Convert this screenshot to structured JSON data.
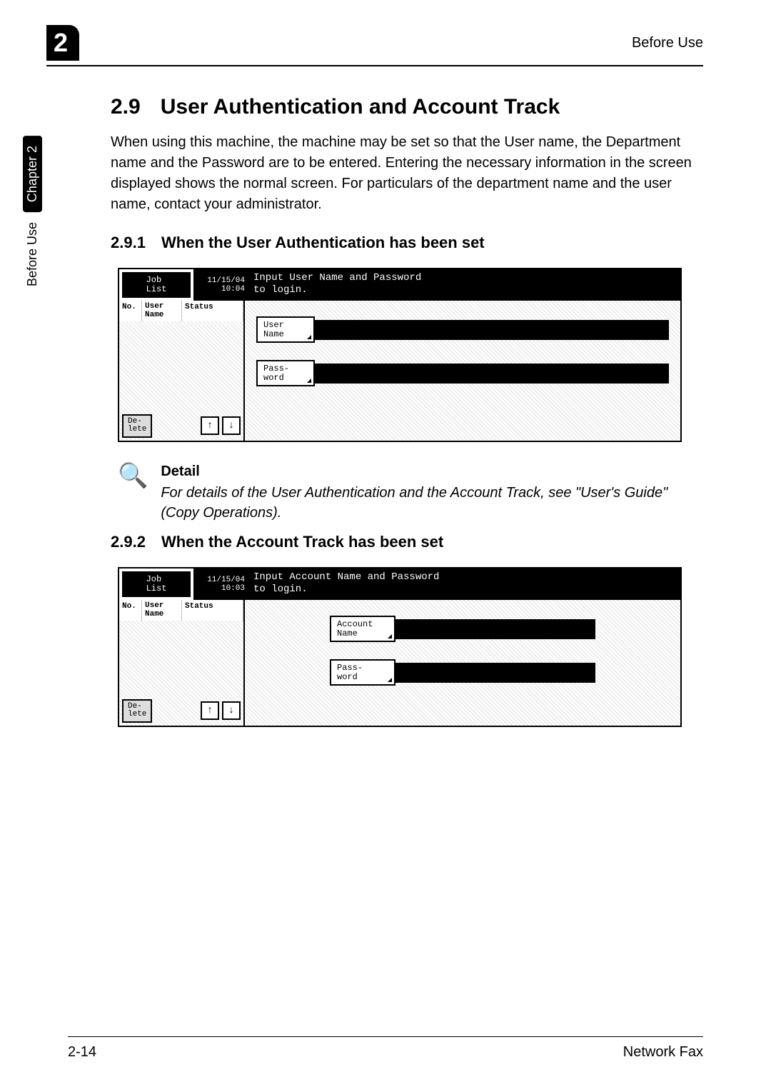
{
  "header": {
    "chapter_badge": "2",
    "running_head": "Before Use"
  },
  "sidebar": {
    "chapter_label": "Chapter 2",
    "section_label": "Before Use"
  },
  "section": {
    "number": "2.9",
    "title": "User Authentication and Account Track",
    "intro": "When using this machine, the machine may be set so that the User name, the Department name and the Password are to be entered. Entering the necessary information in the screen displayed shows the normal screen. For particulars of the department name and the user name, contact your administrator."
  },
  "sub1": {
    "number": "2.9.1",
    "title": "When the User Authentication has been set"
  },
  "panel1": {
    "joblist": "Job\nList",
    "date": "11/15/04",
    "time": "10:04",
    "prompt": "Input User Name and Password\nto login.",
    "col_no": "No.",
    "col_user": "User\nName",
    "col_status": "Status",
    "delete": "De-\nlete",
    "up": "↑",
    "down": "↓",
    "field1": "User\nName",
    "field2": "Pass-\nword"
  },
  "detail": {
    "heading": "Detail",
    "body": "For details of the User Authentication and the Account Track, see \"User's Guide\" (Copy Operations)."
  },
  "sub2": {
    "number": "2.9.2",
    "title": "When the Account Track has been set"
  },
  "panel2": {
    "joblist": "Job\nList",
    "date": "11/15/04",
    "time": "10:03",
    "prompt": "Input Account Name and Password\nto login.",
    "col_no": "No.",
    "col_user": "User\nName",
    "col_status": "Status",
    "delete": "De-\nlete",
    "up": "↑",
    "down": "↓",
    "field1": "Account\nName",
    "field2": "Pass-\nword"
  },
  "footer": {
    "page": "2-14",
    "doc": "Network Fax"
  }
}
